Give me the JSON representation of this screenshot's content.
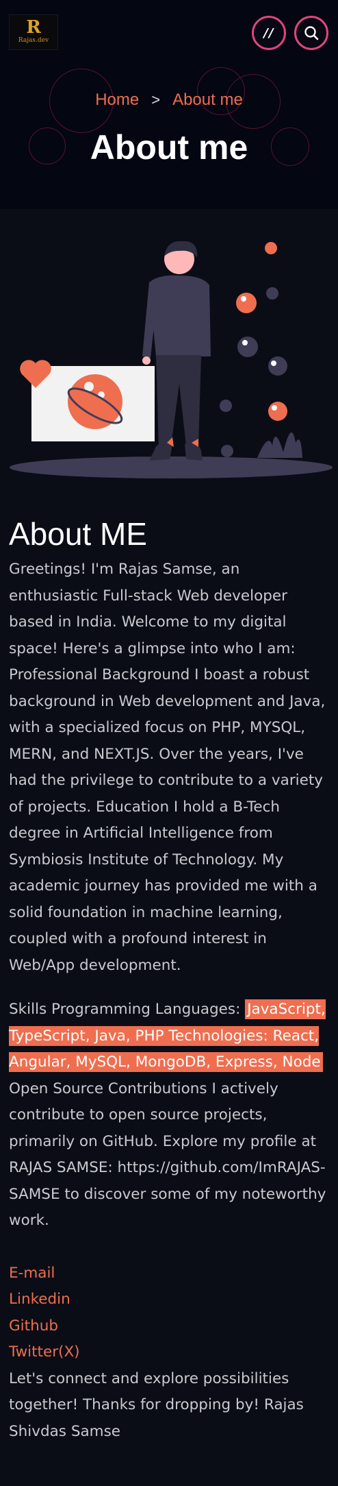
{
  "header": {
    "logo": {
      "mark": "R",
      "name": "Rajas.dev"
    },
    "menu_button": {
      "glyph": "//"
    }
  },
  "hero": {
    "breadcrumb": {
      "home": "Home",
      "separator": ">",
      "current": "About me"
    },
    "title": "About me"
  },
  "about": {
    "title": "About ME",
    "intro": "Greetings! I'm Rajas Samse, an enthusiastic Full-stack Web developer based in India. Welcome to my digital space! Here's a glimpse into who I am: Professional Background I boast a robust background in Web development and Java, with a specialized focus on PHP, MYSQL, MERN, and NEXT.JS. Over the years, I've had the privilege to contribute to a variety of projects. Education I hold a B-Tech degree in Artificial Intelligence from Symbiosis Institute of Technology. My academic journey has provided me with a solid foundation in machine learning, coupled with a profound interest in Web/App development.",
    "skills_prefix": "Skills Programming Languages: ",
    "skills_highlight": "JavaScript, TypeScript, Java, PHP Technologies: React, Angular, MySQL, MongoDB, Express, Node",
    "open_source": "Open Source Contributions I actively contribute to open source projects, primarily on GitHub. Explore my profile at RAJAS SAMSE: https://github.com/ImRAJAS-SAMSE to discover some of my noteworthy work.",
    "links": [
      "E-mail",
      "Linkedin",
      "Github",
      "Twitter(X)"
    ],
    "closing": "Let's connect and explore possibilities together! Thanks for dropping by! Rajas Shivdas Samse"
  },
  "colors": {
    "accent": "#ee6e4f",
    "button_ring": "#e0457b",
    "hero_bg": "#040612",
    "page_bg": "#0b0d16"
  },
  "icons": [
    "search-icon",
    "heart-icon"
  ]
}
